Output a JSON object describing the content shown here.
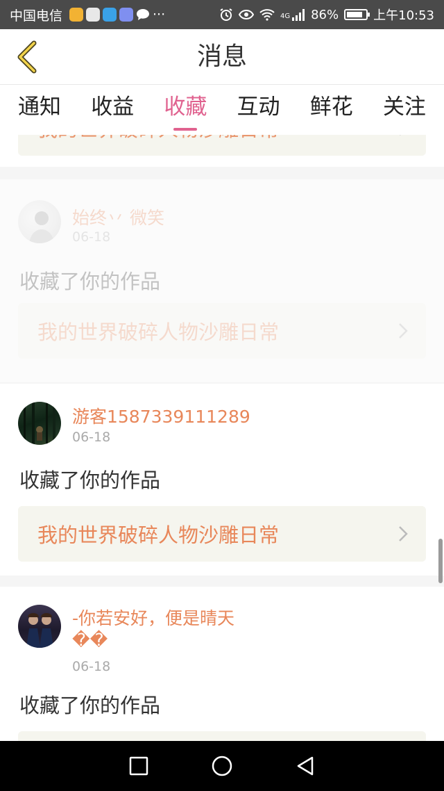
{
  "status_bar": {
    "carrier": "中国电信",
    "overflow": "···",
    "network": "4G",
    "battery": "86%",
    "battery_level": 0.86,
    "time": "上午10:53"
  },
  "header": {
    "title": "消息"
  },
  "tabs": [
    {
      "label": "通知",
      "active": false
    },
    {
      "label": "收益",
      "active": false
    },
    {
      "label": "收藏",
      "active": true
    },
    {
      "label": "互动",
      "active": false
    },
    {
      "label": "鲜花",
      "active": false
    },
    {
      "label": "关注",
      "active": false
    }
  ],
  "feed": {
    "partial_top": {
      "work_title": "我的世界破碎人物沙雕日常"
    },
    "items": [
      {
        "username": "始终丷 微笑",
        "date": "06-18",
        "action": "收藏了你的作品",
        "work_title": "我的世界破碎人物沙雕日常"
      },
      {
        "username": "游客1587339111289",
        "date": "06-18",
        "action": "收藏了你的作品",
        "work_title": "我的世界破碎人物沙雕日常"
      },
      {
        "username": "-你若安好，便是晴天",
        "username_line2": "��",
        "date": "06-18",
        "action": "收藏了你的作品"
      }
    ]
  },
  "colors": {
    "accent_pink": "#e0628f",
    "accent_orange": "#e8875a",
    "link_bg": "#f5f5ee",
    "status_bar_bg": "#4a4a4a"
  }
}
